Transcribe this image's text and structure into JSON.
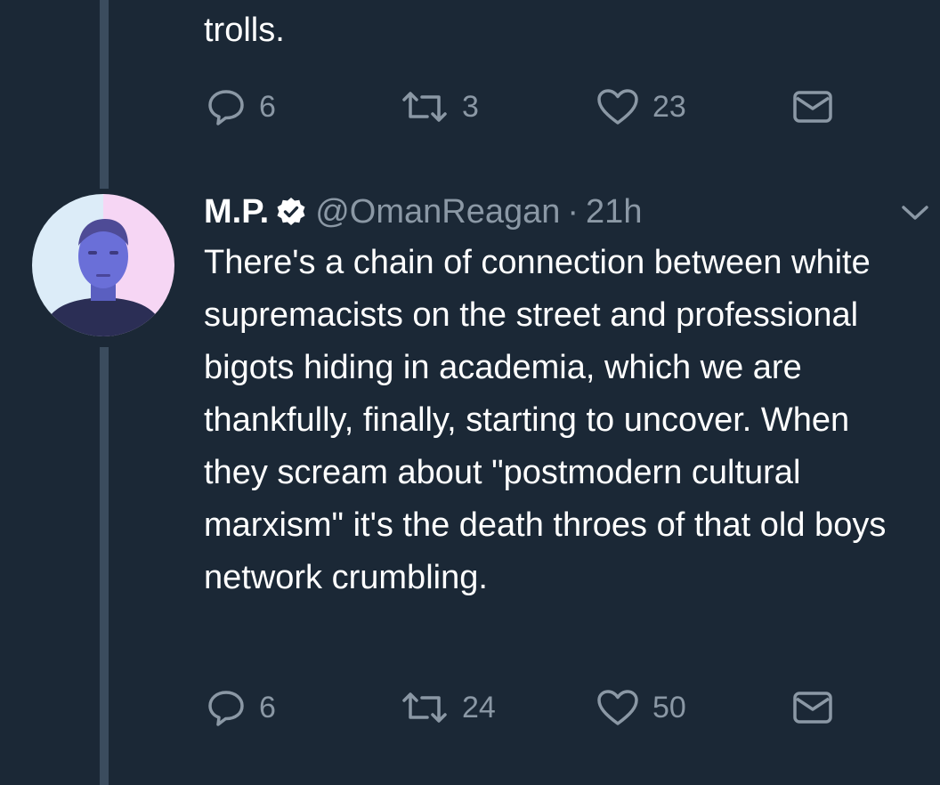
{
  "previous_tweet": {
    "text_tail": "trolls.",
    "actions": {
      "reply_count": "6",
      "retweet_count": "3",
      "like_count": "23"
    }
  },
  "tweet": {
    "display_name": "M.P.",
    "handle": "@OmanReagan",
    "separator": "·",
    "time": "21h",
    "verified": true,
    "text": "There's a chain of connection between white supremacists on the street and professional bigots hiding in academia, which we are thankfully, finally, starting to uncover. When they scream about \"postmodern cultural marxism\" it's the death throes of that old boys network crumbling.",
    "actions": {
      "reply_count": "6",
      "retweet_count": "24",
      "like_count": "50"
    }
  },
  "icons": {
    "reply": "reply-icon",
    "retweet": "retweet-icon",
    "like": "heart-icon",
    "dm": "envelope-icon",
    "verified": "verified-badge-icon",
    "more": "chevron-down-icon"
  },
  "colors": {
    "background": "#1b2836",
    "text": "#ffffff",
    "secondary_text": "#8b98a5",
    "thread_line": "#3b4c5e",
    "verified_badge": "#ffffff"
  }
}
